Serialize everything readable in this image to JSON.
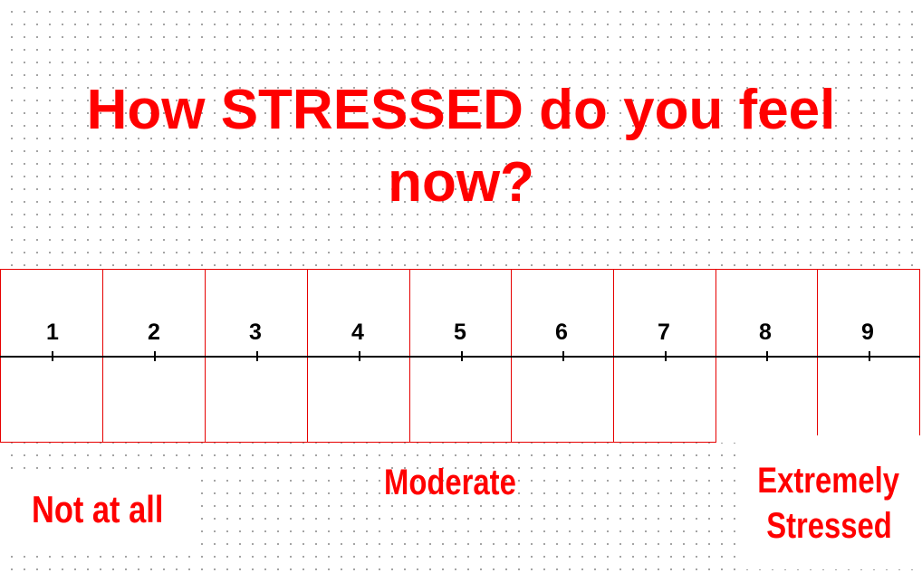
{
  "question": {
    "text": "How STRESSED do you feel now?"
  },
  "scale": {
    "points": [
      "1",
      "2",
      "3",
      "4",
      "5",
      "6",
      "7",
      "8",
      "9"
    ],
    "selected": null
  },
  "anchors": {
    "low": "Not at all",
    "mid": "Moderate",
    "high_line1": "Extremely",
    "high_line2": "Stressed"
  },
  "colors": {
    "accent": "#ff0000",
    "grid_border": "#e60000",
    "scale_line": "#000000",
    "background_dots": "#8a8a8a"
  }
}
